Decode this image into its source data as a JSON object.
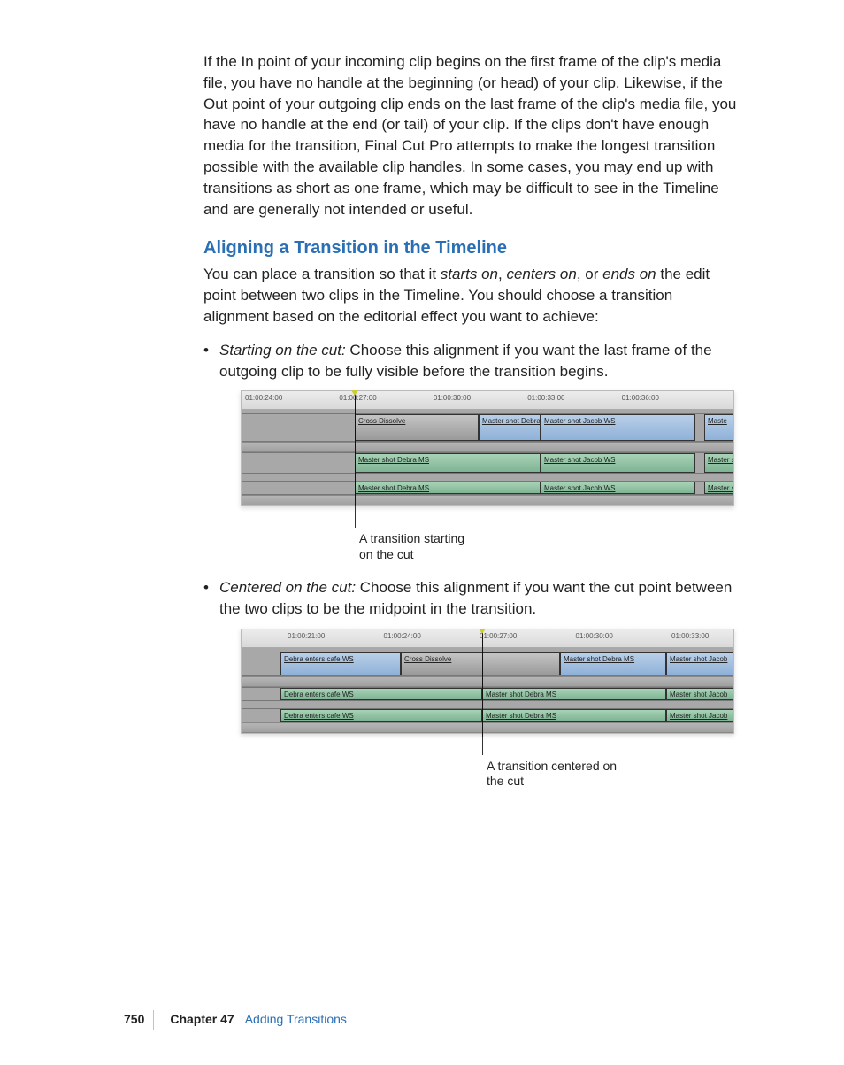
{
  "para1": "If the In point of your incoming clip begins on the first frame of the clip's media file, you have no handle at the beginning (or head) of your clip. Likewise, if the Out point of your outgoing clip ends on the last frame of the clip's media file, you have no handle at the end (or tail) of your clip. If the clips don't have enough media for the transition, Final Cut Pro attempts to make the longest transition possible with the available clip handles. In some cases, you may end up with transitions as short as one frame, which may be difficult to see in the Timeline and are generally not intended or useful.",
  "heading": "Aligning a Transition in the Timeline",
  "para2a": "You can place a transition so that it ",
  "para2_starts": "starts on",
  "para2b": ", ",
  "para2_centers": "centers on",
  "para2c": ", or ",
  "para2_ends": "ends on",
  "para2d": " the edit point between two clips in the Timeline. You should choose a transition alignment based on the editorial effect you want to achieve:",
  "bullets": {
    "starting": {
      "label": "Starting on the cut:",
      "text": "  Choose this alignment if you want the last frame of the outgoing clip to be fully visible before the transition begins."
    },
    "centered": {
      "label": "Centered on the cut:",
      "text": "  Choose this alignment if you want the cut point between the two clips to be the midpoint in the transition."
    }
  },
  "shot1": {
    "ruler": [
      "01:00:24:00",
      "01:00:27:00",
      "01:00:30:00",
      "01:00:33:00",
      "01:00:36:00",
      ""
    ],
    "trans": "Cross Dissolve",
    "clip_v1a": "Master shot Debra MS",
    "clip_v1b": "Master shot Jacob WS",
    "clip_v1c": "Maste",
    "clip_a1a": "Master shot Debra MS",
    "clip_a1b": "Master shot Jacob WS",
    "clip_a1c": "Master s",
    "clip_a2a": "Master shot Debra MS",
    "clip_a2b": "Master shot Jacob WS",
    "clip_a2c": "Master s",
    "caption": "A transition starting on the cut"
  },
  "shot2": {
    "ruler": [
      "01:00:21:00",
      "01:00:24:00",
      "01:00:27:00",
      "01:00:30:00",
      "01:00:33:00"
    ],
    "trans": "Cross Dissolve",
    "clip_v1a": "Debra enters cafe WS",
    "clip_v1b": "Master shot Debra MS",
    "clip_v1c": "Master shot Jacob",
    "clip_a1a": "Debra enters cafe WS",
    "clip_a1b": "Master shot Debra MS",
    "clip_a1c": "Master shot Jacob",
    "clip_a2a": "Debra enters cafe WS",
    "clip_a2b": "Master shot Debra MS",
    "clip_a2c": "Master shot Jacob",
    "caption": "A transition centered on the cut"
  },
  "footer": {
    "page": "750",
    "chapter": "Chapter 47",
    "title": "Adding Transitions"
  }
}
